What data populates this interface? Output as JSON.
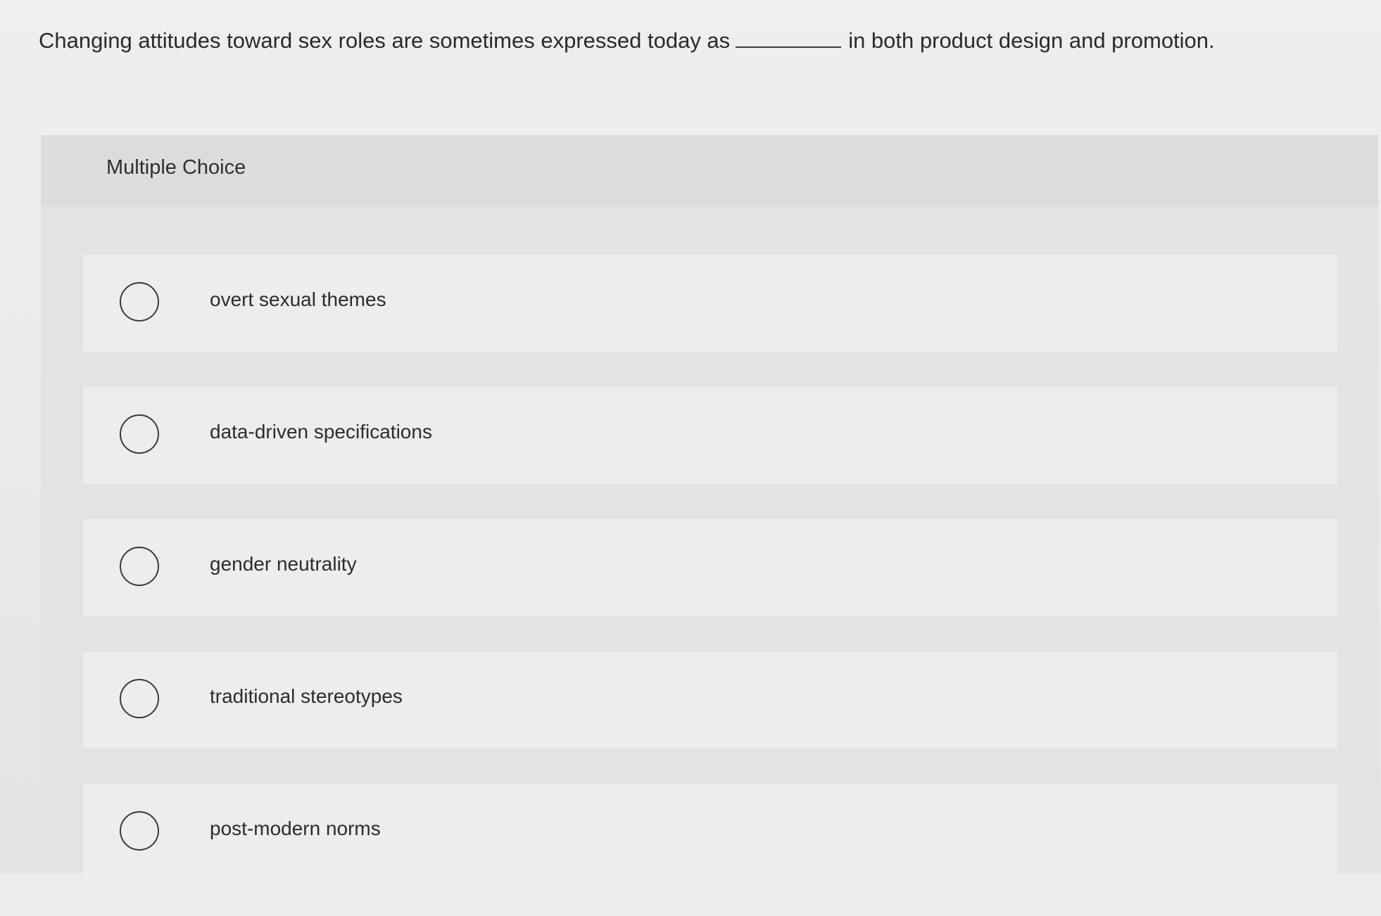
{
  "question": {
    "text_before": "Changing attitudes toward sex roles are sometimes expressed today as",
    "text_after": "in both product design and promotion."
  },
  "panel": {
    "label": "Multiple Choice"
  },
  "options": [
    {
      "label": "overt sexual themes",
      "selected": false
    },
    {
      "label": "data-driven specifications",
      "selected": false
    },
    {
      "label": "gender neutrality",
      "selected": false
    },
    {
      "label": "traditional stereotypes",
      "selected": false
    },
    {
      "label": "post-modern norms",
      "selected": false
    }
  ]
}
